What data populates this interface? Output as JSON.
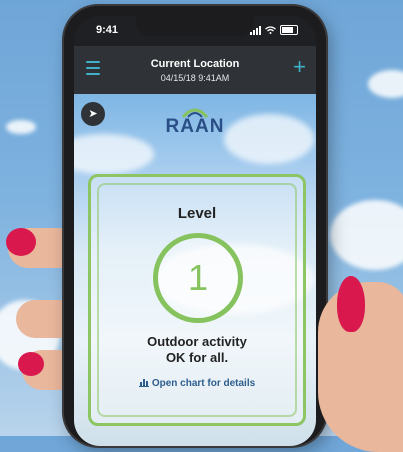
{
  "status_bar": {
    "time": "9:41"
  },
  "app_bar": {
    "title": "Current Location",
    "timestamp": "04/15/18 9:41AM",
    "menu_icon": "hamburger-icon",
    "add_icon": "plus-icon"
  },
  "logo": {
    "text": "RAAN"
  },
  "level_card": {
    "label": "Level",
    "value": "1",
    "message_line1": "Outdoor activity",
    "message_line2": "OK for all.",
    "chart_link": "Open chart for details",
    "accent_color": "#86c35e"
  },
  "locate_icon": "navigation-arrow-icon"
}
